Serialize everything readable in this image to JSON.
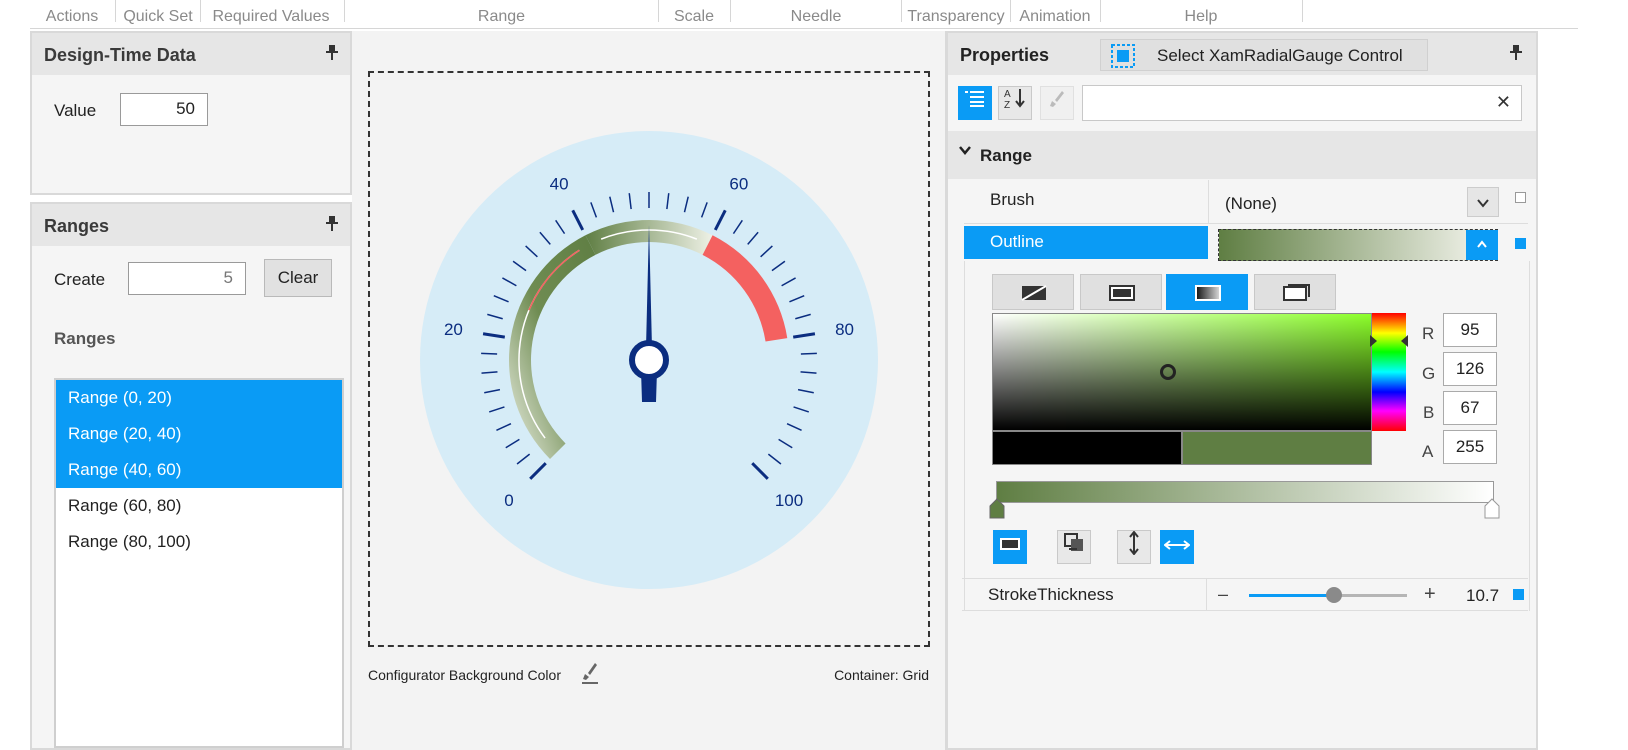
{
  "ribbon": {
    "tabs": [
      "Actions",
      "Quick Set",
      "Required Values",
      "Range",
      "Scale",
      "Needle",
      "Transparency",
      "Animation",
      "Help"
    ]
  },
  "design_time": {
    "title": "Design-Time Data",
    "value_label": "Value",
    "value": "50"
  },
  "ranges": {
    "title": "Ranges",
    "create_label": "Create",
    "create_value": "5",
    "clear_label": "Clear",
    "list_heading": "Ranges",
    "items": [
      {
        "label": "Range (0, 20)",
        "selected": true
      },
      {
        "label": "Range (20, 40)",
        "selected": true
      },
      {
        "label": "Range (40, 60)",
        "selected": true
      },
      {
        "label": "Range (60, 80)",
        "selected": false
      },
      {
        "label": "Range (80, 100)",
        "selected": false
      }
    ]
  },
  "gauge": {
    "labels": [
      "0",
      "20",
      "40",
      "60",
      "80",
      "100"
    ],
    "min": 0,
    "max": 100,
    "value": 50,
    "start_angle_deg": 135,
    "sweep_deg": 270,
    "ranges": [
      {
        "start": 0,
        "end": 40,
        "color": "#8aa06b"
      },
      {
        "start": 40,
        "end": 60,
        "color": "#607e43"
      },
      {
        "start": 60,
        "end": 80,
        "color": "#f46160"
      }
    ],
    "needle_color": "#0b2d80",
    "background": "#d6ecf7"
  },
  "canvas_footer": {
    "bg_color_label": "Configurator Background Color",
    "container_label": "Container: Grid"
  },
  "properties": {
    "title": "Properties",
    "select_label": "Select XamRadialGauge Control",
    "category": "Range",
    "brush_label": "Brush",
    "brush_value": "(None)",
    "outline_label": "Outline",
    "stroke_label": "StrokeThickness",
    "stroke_value": "10.7",
    "stroke_minus": "–",
    "stroke_plus": "+",
    "rgba": {
      "r": "95",
      "g": "126",
      "b": "67",
      "a": "255"
    },
    "rgba_labels": {
      "r": "R",
      "g": "G",
      "b": "B",
      "a": "A"
    },
    "selected_color": "#5f7e43",
    "accent": "#0a9bf5"
  }
}
